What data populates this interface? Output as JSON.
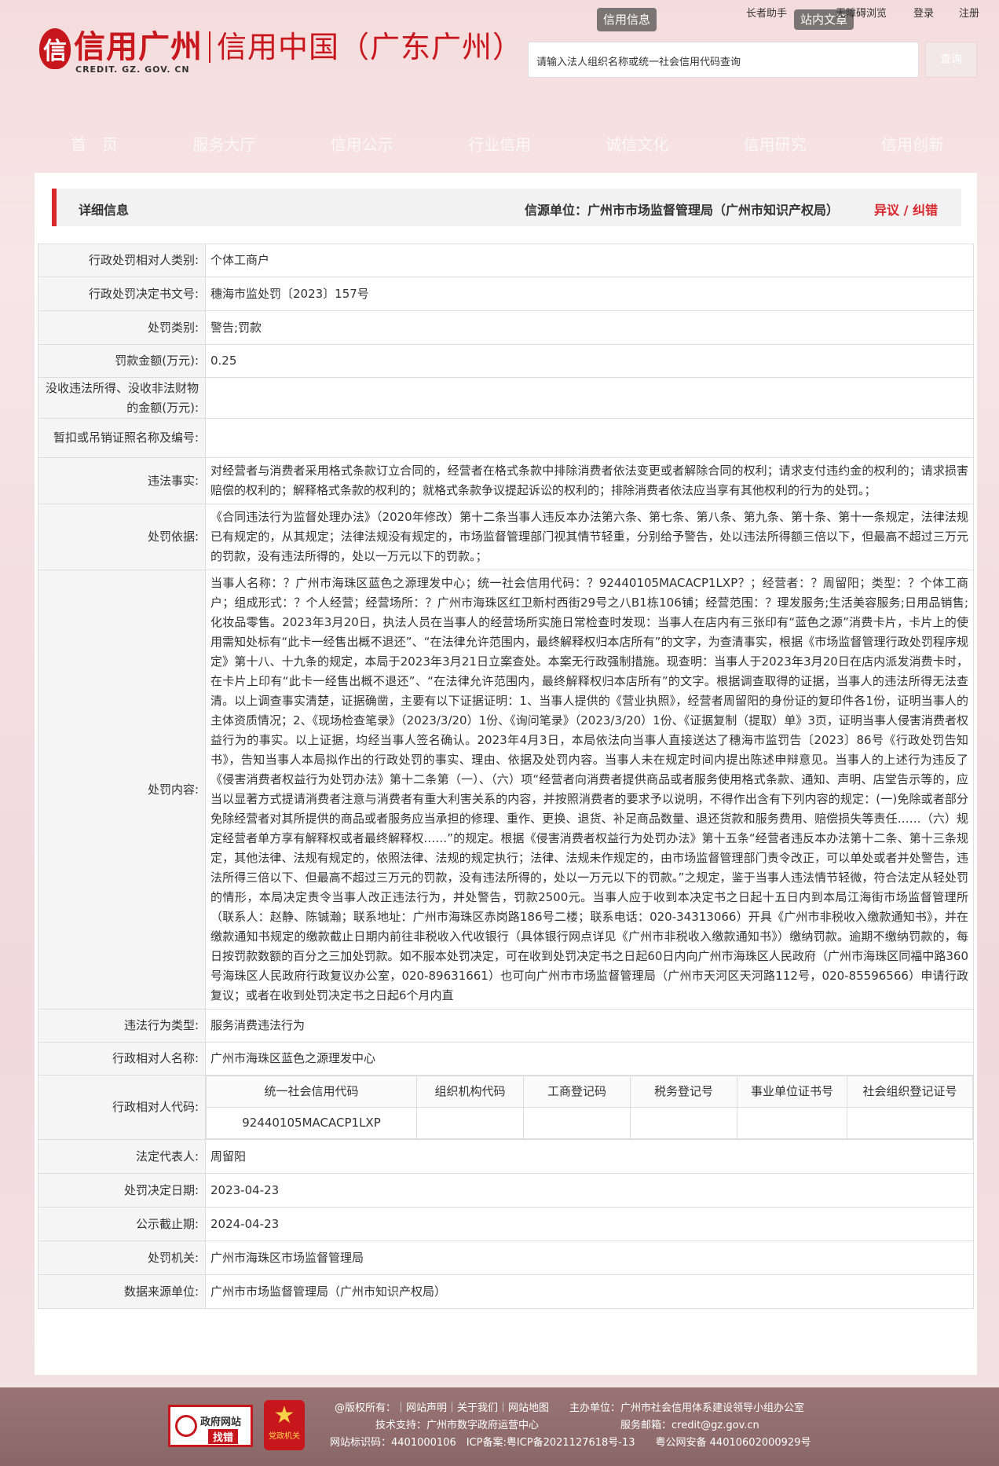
{
  "header": {
    "logo_mark": "信",
    "logo_cn": "信用广州",
    "logo_cn2": "信用中国（广东广州）",
    "logo_en": "CREDIT. GZ. GOV. CN",
    "tab_credit_info": "信用信息",
    "tab_site_article": "站内文章",
    "links": {
      "elder": "长者助手",
      "barrier_free": "无障碍浏览",
      "login": "登录",
      "register": "注册"
    },
    "search_placeholder": "请输入法人组织名称或统一社会信用代码查询",
    "search_button": "查询",
    "nav": [
      "首　页",
      "服务大厅",
      "信用公示",
      "行业信用",
      "诚信文化",
      "信用研究",
      "信用创新"
    ]
  },
  "panel": {
    "title": "详细信息",
    "source": "信源单位：广州市市场监督管理局（广州市知识产权局）",
    "objection": "异议 / 纠错"
  },
  "rows": [
    {
      "label": "行政处罚相对人类别:",
      "value": "个体工商户"
    },
    {
      "label": "行政处罚决定书文号:",
      "value": "穗海市监处罚〔2023〕157号"
    },
    {
      "label": "处罚类别:",
      "value": "警告;罚款"
    },
    {
      "label": "罚款金额(万元):",
      "value": "0.25"
    },
    {
      "label": "没收违法所得、没收非法财物的金额(万元):",
      "value": ""
    },
    {
      "label": "暂扣或吊销证照名称及编号:",
      "value": ""
    },
    {
      "label": "违法事实:",
      "value": "对经营者与消费者采用格式条款订立合同的，经营者在格式条款中排除消费者依法变更或者解除合同的权利；请求支付违约金的权利的；请求损害赔偿的权利的；解释格式条款的权利的；就格式条款争议提起诉讼的权利的；排除消费者依法应当享有其他权利的行为的处罚。；"
    },
    {
      "label": "处罚依据:",
      "value": "《合同违法行为监督处理办法》（2020年修改）第十二条当事人违反本办法第六条、第七条、第八条、第九条、第十条、第十一条规定，法律法规已有规定的，从其规定；法律法规没有规定的，市场监督管理部门视其情节轻重，分别给予警告，处以违法所得额三倍以下，但最高不超过三万元的罚款，没有违法所得的，处以一万元以下的罚款。；"
    },
    {
      "label": "处罚内容:",
      "value": "当事人名称：？广州市海珠区蓝色之源理发中心；统一社会信用代码：？92440105MACACP1LXP？；经营者：？周留阳；类型：？个体工商户；组成形式：？个人经营；经营场所：？广州市海珠区红卫新村西街29号之八B1栋106铺；经营范围：？理发服务;生活美容服务;日用品销售;化妆品零售。2023年3月20日，执法人员在当事人的经营场所实施日常检查时发现：当事人在店内有三张印有“蓝色之源”消费卡片，卡片上的使用需知处标有“此卡一经售出概不退还”、“在法律允许范围内，最终解释权归本店所有”的文字，为查清事实，根据《市场监督管理行政处罚程序规定》第十八、十九条的规定，本局于2023年3月21日立案查处。本案无行政强制措施。现查明：当事人于2023年3月20日在店内派发消费卡时，在卡片上印有“此卡一经售出概不退还”、“在法律允许范围内，最终解释权归本店所有”的文字。根据调查取得的证据，当事人的违法所得无法查清。以上调查事实清楚，证据确凿，主要有以下证据证明：1、当事人提供的《营业执照》，经营者周留阳的身份证的复印件各1份，证明当事人的主体资质情况；2、《现场检查笔录》（2023/3/20）1份、《询问笔录》（2023/3/20）1份、《证据复制（提取）单》3页，证明当事人侵害消费者权益行为的事实。以上证据，均经当事人签名确认。2023年4月3日，本局依法向当事人直接送达了穗海市监罚告〔2023〕86号《行政处罚告知书》，告知当事人本局拟作出的行政处罚的事实、理由、依据及处罚内容。当事人未在规定时间内提出陈述申辩意见。当事人的上述行为违反了《侵害消费者权益行为处罚办法》第十二条第（一）、（六）项“经营者向消费者提供商品或者服务使用格式条款、通知、声明、店堂告示等的，应当以显著方式提请消费者注意与消费者有重大利害关系的内容，并按照消费者的要求予以说明，不得作出含有下列内容的规定：(一)免除或者部分免除经营者对其所提供的商品或者服务应当承担的修理、重作、更换、退货、补足商品数量、退还货款和服务费用、赔偿损失等责任……（六）规定经营者单方享有解释权或者最终解释权……”的规定。根据《侵害消费者权益行为处罚办法》第十五条“经营者违反本办法第十二条、第十三条规定，其他法律、法规有规定的，依照法律、法规的规定执行；法律、法规未作规定的，由市场监督管理部门责令改正，可以单处或者并处警告，违法所得三倍以下、但最高不超过三万元的罚款，没有违法所得的，处以一万元以下的罚款。”之规定，鉴于当事人违法情节轻微，符合法定从轻处罚的情形，本局决定责令当事人改正违法行为，并处警告，罚款2500元。当事人应于收到本决定书之日起十五日内到本局江海街市场监督管理所（联系人：赵静、陈铖瀚；联系地址：广州市海珠区赤岗路186号二楼；联系电话：020-34313066）开具《广州市非税收入缴款通知书》，并在缴款通知书规定的缴款截止日期内前往非税收入代收银行（具体银行网点详见《广州市非税收入缴款通知书》）缴纳罚款。逾期不缴纳罚款的，每日按罚款数额的百分之三加处罚款。如不服本处罚决定，可在收到处罚决定书之日起60日内向广州市海珠区人民政府（广州市海珠区同福中路360号海珠区人民政府行政复议办公室，020-89631661）也可向广州市市场监督管理局（广州市天河区天河路112号，020-85596566）申请行政复议；或者在收到处罚决定书之日起6个月内直"
    },
    {
      "label": "违法行为类型:",
      "value": "服务消费违法行为"
    },
    {
      "label": "行政相对人名称:",
      "value": "广州市海珠区蓝色之源理发中心"
    }
  ],
  "codes": {
    "label": "行政相对人代码:",
    "headers": [
      "统一社会信用代码",
      "组织机构代码",
      "工商登记码",
      "税务登记号",
      "事业单位证书号",
      "社会组织登记证号"
    ],
    "values": [
      "92440105MACACP1LXP",
      "",
      "",
      "",
      "",
      ""
    ]
  },
  "rows_after": [
    {
      "label": "法定代表人:",
      "value": "周留阳"
    },
    {
      "label": "处罚决定日期:",
      "value": "2023-04-23"
    },
    {
      "label": "公示截止期:",
      "value": "2024-04-23"
    },
    {
      "label": "处罚机关:",
      "value": "广州市海珠区市场监督管理局"
    },
    {
      "label": "数据来源单位:",
      "value": "广州市市场监督管理局（广州市知识产权局）"
    }
  ],
  "footer": {
    "gov_badge_line1": "政府网站",
    "gov_badge_line2": "找错",
    "party_label": "党政机关",
    "line1": "@版权所有：｜网站声明｜关于我们｜网站地图　　主办单位：广州市社会信用体系建设领导小组办公室",
    "line2": "技术支持：广州市数字政府运营中心　　　　　　　　服务邮箱：credit@gz.gov.cn",
    "line3": "网站标识码：4401000106　ICP备案:粤ICP备2021127618号-13　　粤公网安备 44010602000929号"
  }
}
